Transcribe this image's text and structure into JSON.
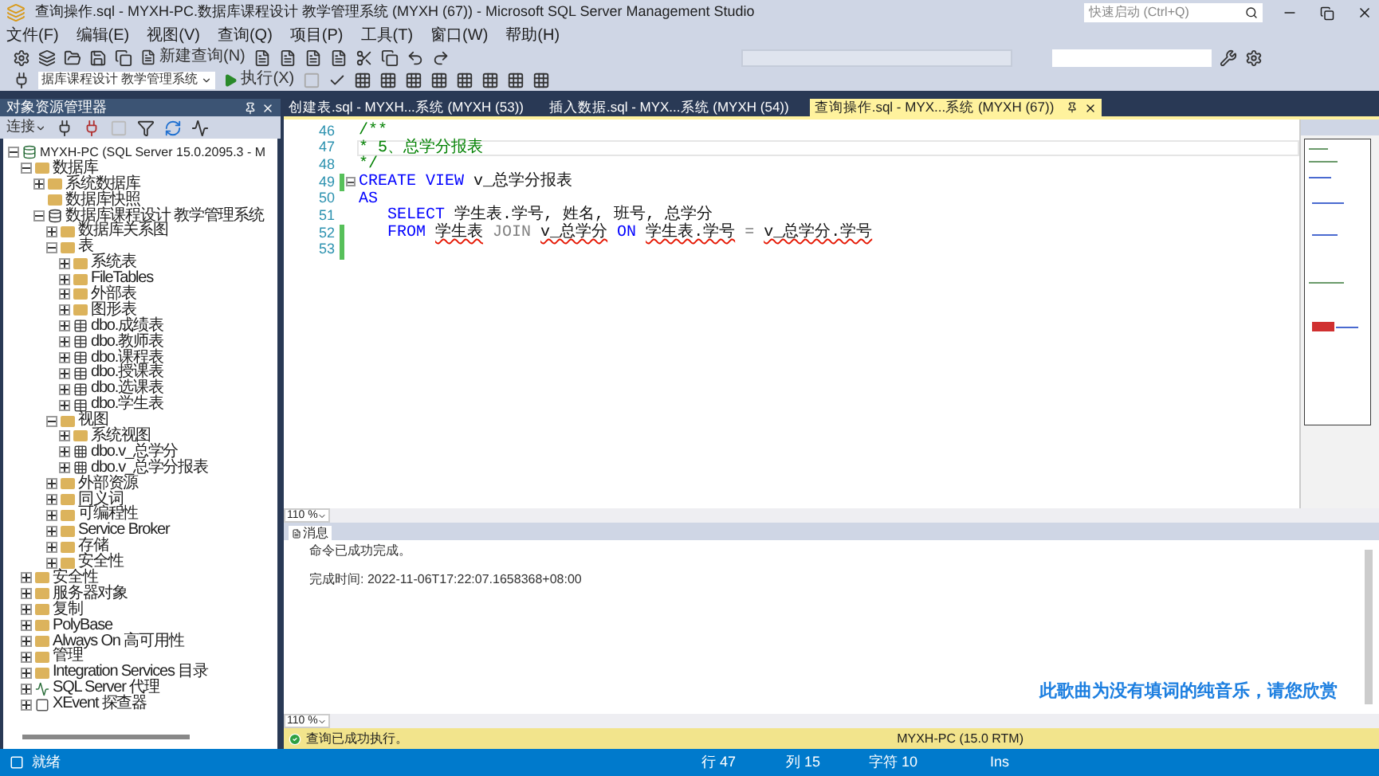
{
  "window": {
    "title": "查询操作.sql - MYXH-PC.数据库课程设计 教学管理系统 (MYXH (67)) - Microsoft SQL Server Management Studio",
    "quick_launch": {
      "placeholder": "快速启动 (Ctrl+Q)"
    }
  },
  "menu": [
    "文件(F)",
    "编辑(E)",
    "视图(V)",
    "查询(Q)",
    "项目(P)",
    "工具(T)",
    "窗口(W)",
    "帮助(H)"
  ],
  "toolbar": {
    "new_query": "新建查询(N)",
    "database": "据库课程设计 教学管理系统",
    "execute": "执行(X)"
  },
  "object_explorer": {
    "title": "对象资源管理器",
    "connect": "连接",
    "tree": [
      {
        "label": "MYXH-PC (SQL Server 15.0.2095.3 - M",
        "kind": "server",
        "expanded": true,
        "children": [
          {
            "label": "数据库",
            "kind": "folder",
            "expanded": true,
            "children": [
              {
                "label": "系统数据库",
                "kind": "folder",
                "expanded": false
              },
              {
                "label": "数据库快照",
                "kind": "folder"
              },
              {
                "label": "数据库课程设计 教学管理系统",
                "kind": "database",
                "expanded": true,
                "children": [
                  {
                    "label": "数据库关系图",
                    "kind": "folder",
                    "expanded": false
                  },
                  {
                    "label": "表",
                    "kind": "folder",
                    "expanded": true,
                    "children": [
                      {
                        "label": "系统表",
                        "kind": "folder",
                        "expanded": false
                      },
                      {
                        "label": "FileTables",
                        "kind": "folder",
                        "expanded": false
                      },
                      {
                        "label": "外部表",
                        "kind": "folder",
                        "expanded": false
                      },
                      {
                        "label": "图形表",
                        "kind": "folder",
                        "expanded": false
                      },
                      {
                        "label": "dbo.成绩表",
                        "kind": "table",
                        "expanded": false
                      },
                      {
                        "label": "dbo.教师表",
                        "kind": "table",
                        "expanded": false
                      },
                      {
                        "label": "dbo.课程表",
                        "kind": "table",
                        "expanded": false
                      },
                      {
                        "label": "dbo.授课表",
                        "kind": "table",
                        "expanded": false
                      },
                      {
                        "label": "dbo.选课表",
                        "kind": "table",
                        "expanded": false
                      },
                      {
                        "label": "dbo.学生表",
                        "kind": "table",
                        "expanded": false
                      }
                    ]
                  },
                  {
                    "label": "视图",
                    "kind": "folder",
                    "expanded": true,
                    "children": [
                      {
                        "label": "系统视图",
                        "kind": "folder",
                        "expanded": false
                      },
                      {
                        "label": "dbo.v_总学分",
                        "kind": "view",
                        "expanded": false
                      },
                      {
                        "label": "dbo.v_总学分报表",
                        "kind": "view",
                        "expanded": false
                      }
                    ]
                  },
                  {
                    "label": "外部资源",
                    "kind": "folder",
                    "expanded": false
                  },
                  {
                    "label": "同义词",
                    "kind": "folder",
                    "expanded": false
                  },
                  {
                    "label": "可编程性",
                    "kind": "folder",
                    "expanded": false
                  },
                  {
                    "label": "Service Broker",
                    "kind": "folder",
                    "expanded": false
                  },
                  {
                    "label": "存储",
                    "kind": "folder",
                    "expanded": false
                  },
                  {
                    "label": "安全性",
                    "kind": "folder",
                    "expanded": false
                  }
                ]
              }
            ]
          },
          {
            "label": "安全性",
            "kind": "folder",
            "expanded": false
          },
          {
            "label": "服务器对象",
            "kind": "folder",
            "expanded": false
          },
          {
            "label": "复制",
            "kind": "folder",
            "expanded": false
          },
          {
            "label": "PolyBase",
            "kind": "folder",
            "expanded": false
          },
          {
            "label": "Always On 高可用性",
            "kind": "folder",
            "expanded": false
          },
          {
            "label": "管理",
            "kind": "folder",
            "expanded": false
          },
          {
            "label": "Integration Services 目录",
            "kind": "folder",
            "expanded": false
          },
          {
            "label": "SQL Server 代理",
            "kind": "agent",
            "expanded": false
          },
          {
            "label": "XEvent 探查器",
            "kind": "xevent",
            "expanded": false
          }
        ]
      }
    ]
  },
  "tabs": [
    {
      "label": "创建表.sql - MYXH...系统 (MYXH (53))",
      "selected": false
    },
    {
      "label": "插入数据.sql - MYX...系统 (MYXH (54))",
      "selected": false
    },
    {
      "label": "查询操作.sql - MYX...系统 (MYXH (67))",
      "selected": true
    }
  ],
  "editor": {
    "zoom": "110 %",
    "lines": [
      {
        "number": "46",
        "changed": false,
        "current": false,
        "fold": false,
        "indented": false,
        "tokens": [
          {
            "kind": "comment",
            "text": "/**"
          }
        ]
      },
      {
        "number": "47",
        "changed": false,
        "current": true,
        "fold": false,
        "indented": false,
        "tokens": [
          {
            "kind": "comment",
            "text": "* 5、总学分报表"
          }
        ]
      },
      {
        "number": "48",
        "changed": false,
        "current": false,
        "fold": false,
        "indented": false,
        "tokens": [
          {
            "kind": "comment",
            "text": "*/"
          }
        ]
      },
      {
        "number": "49",
        "changed": true,
        "current": false,
        "fold": true,
        "indented": false,
        "tokens": [
          {
            "kind": "keyword",
            "text": "CREATE VIEW"
          },
          {
            "kind": "plain",
            "text": "v_总学分报表"
          }
        ]
      },
      {
        "number": "50",
        "changed": false,
        "current": false,
        "fold": false,
        "indented": false,
        "tokens": [
          {
            "kind": "keyword",
            "text": "AS"
          }
        ]
      },
      {
        "number": "51",
        "changed": false,
        "current": false,
        "fold": false,
        "indented": true,
        "tokens": [
          {
            "kind": "keyword",
            "text": "SELECT"
          },
          {
            "kind": "plain",
            "text": "学生表.学号, 姓名, 班号, 总学分"
          }
        ]
      },
      {
        "number": "52",
        "changed": true,
        "current": false,
        "fold": false,
        "indented": true,
        "tokens": [
          {
            "kind": "keyword",
            "text": "FROM"
          },
          {
            "kind": "error",
            "text": "学生表"
          },
          {
            "kind": "gray",
            "text": "JOIN"
          },
          {
            "kind": "error",
            "text": "v_总学分"
          },
          {
            "kind": "keyword",
            "text": "ON"
          },
          {
            "kind": "error",
            "text": "学生表.学号"
          },
          {
            "kind": "gray",
            "text": "="
          },
          {
            "kind": "error",
            "text": "v_总学分.学号"
          }
        ]
      },
      {
        "number": "53",
        "changed": true,
        "current": false,
        "fold": false
      }
    ]
  },
  "results": {
    "tab": "消息",
    "messages": [
      "命令已成功完成。",
      "完成时间: 2022-11-06T17:22:07.1658368+08:00"
    ],
    "zoom": "110 %"
  },
  "query_status": {
    "text": "查询已成功执行。",
    "server": "MYXH-PC (15.0 RTM)"
  },
  "lyrics_overlay": "此歌曲为没有填词的纯音乐，请您欣赏",
  "status_bar": {
    "state": "就绪",
    "line": "行 47",
    "column": "列 15",
    "char": "字符 10",
    "mode": "Ins"
  }
}
